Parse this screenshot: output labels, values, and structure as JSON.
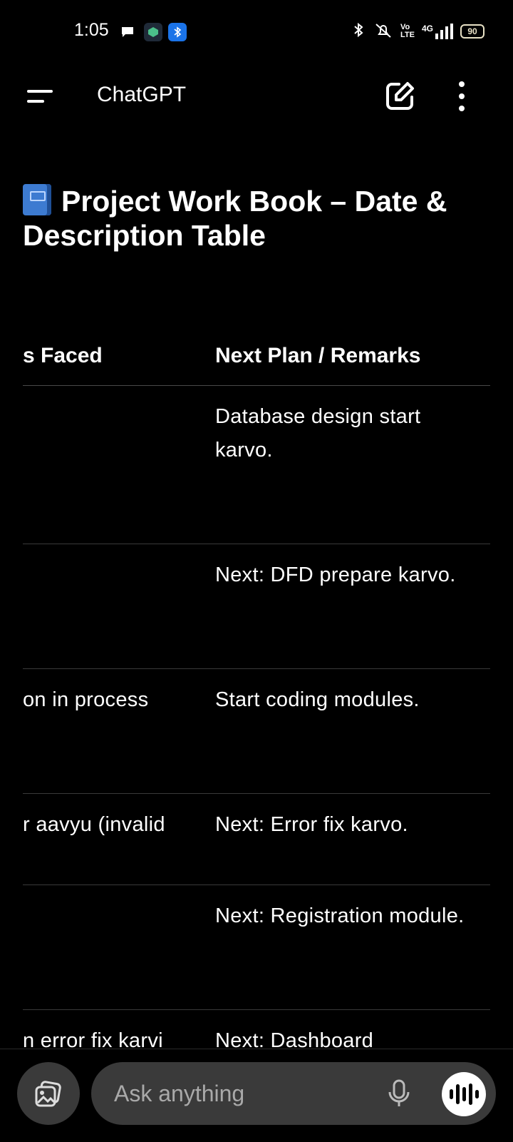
{
  "status_bar": {
    "time": "1:05",
    "battery": "90",
    "network": "4G"
  },
  "app_bar": {
    "title": "ChatGPT"
  },
  "heading": {
    "emoji": "📘",
    "text": "Project Work Book – Date & Description Table"
  },
  "table": {
    "headers": [
      "s Faced",
      "Next Plan / Remarks"
    ],
    "rows": [
      {
        "col1": "",
        "col2": "Database design start karvo."
      },
      {
        "col1": "",
        "col2": "Next: DFD prepare karvo."
      },
      {
        "col1": "on in process",
        "col2": "Start coding modules."
      },
      {
        "col1": "r aavyu (invalid",
        "col2": "Next: Error fix karvo."
      },
      {
        "col1": "",
        "col2": "Next: Registration module."
      },
      {
        "col1": "n error fix karvi",
        "col2": "Next: Dashboard"
      }
    ]
  },
  "composer": {
    "placeholder": "Ask anything"
  },
  "colors": {
    "background": "#000000",
    "surface": "#3a3a3a",
    "text": "#ffffff",
    "placeholder": "#a9a9a9"
  }
}
